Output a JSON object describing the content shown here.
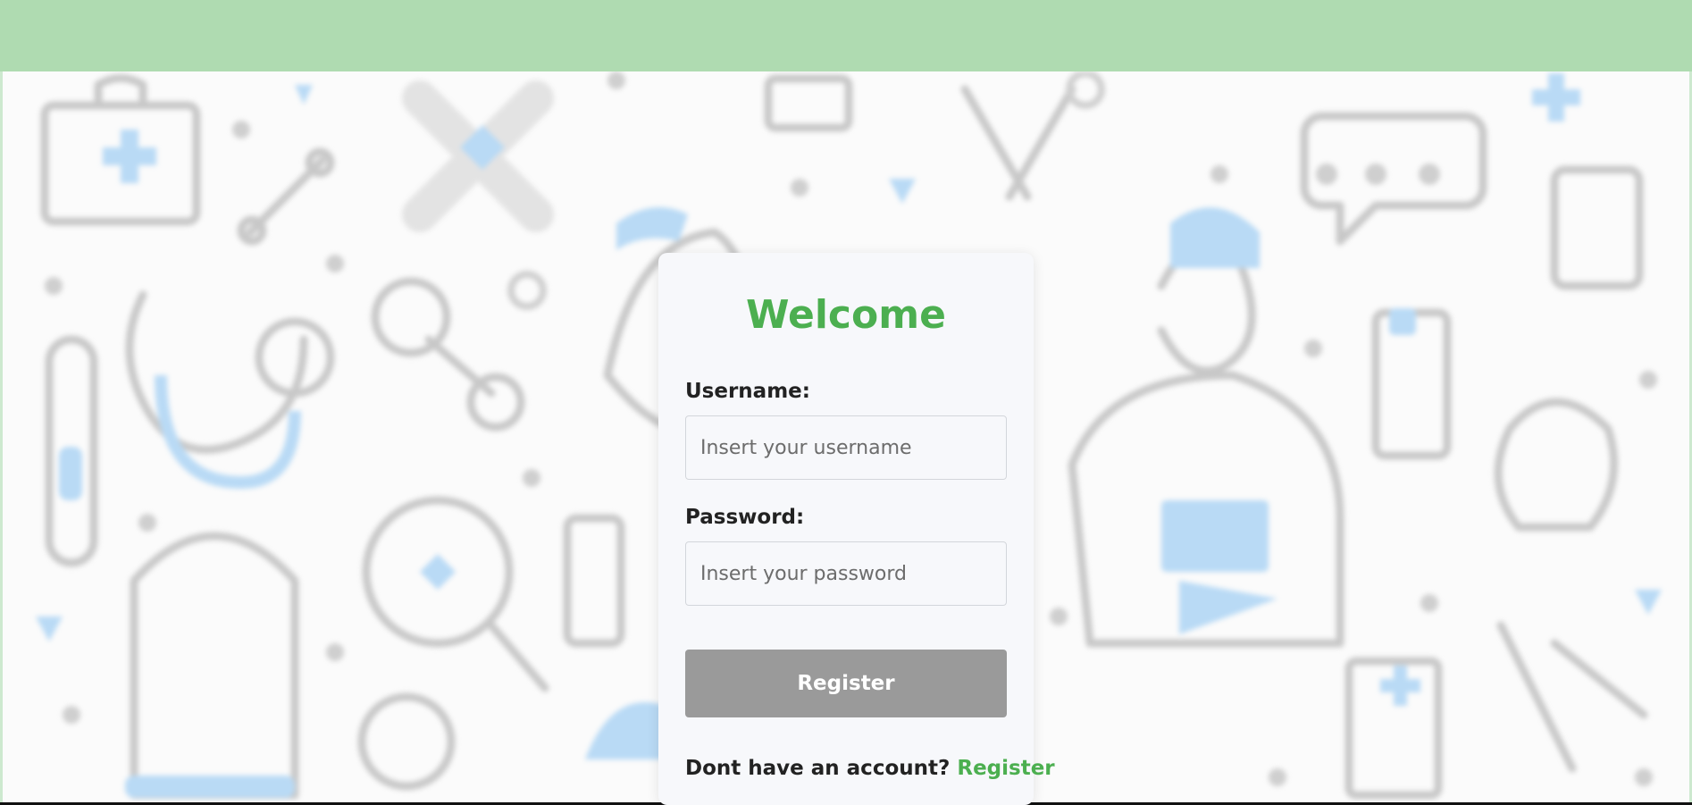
{
  "card": {
    "title": "Welcome",
    "username_label": "Username:",
    "username_placeholder": "Insert your username",
    "password_label": "Password:",
    "password_placeholder": "Insert your password",
    "submit_label": "Register",
    "footer_prompt": "Dont have an account?",
    "footer_link": "Register"
  },
  "colors": {
    "topbar": "#afdbb1",
    "accent": "#4caf50",
    "button": "#9a9a9a",
    "doodle_blue": "#b9daf5"
  }
}
